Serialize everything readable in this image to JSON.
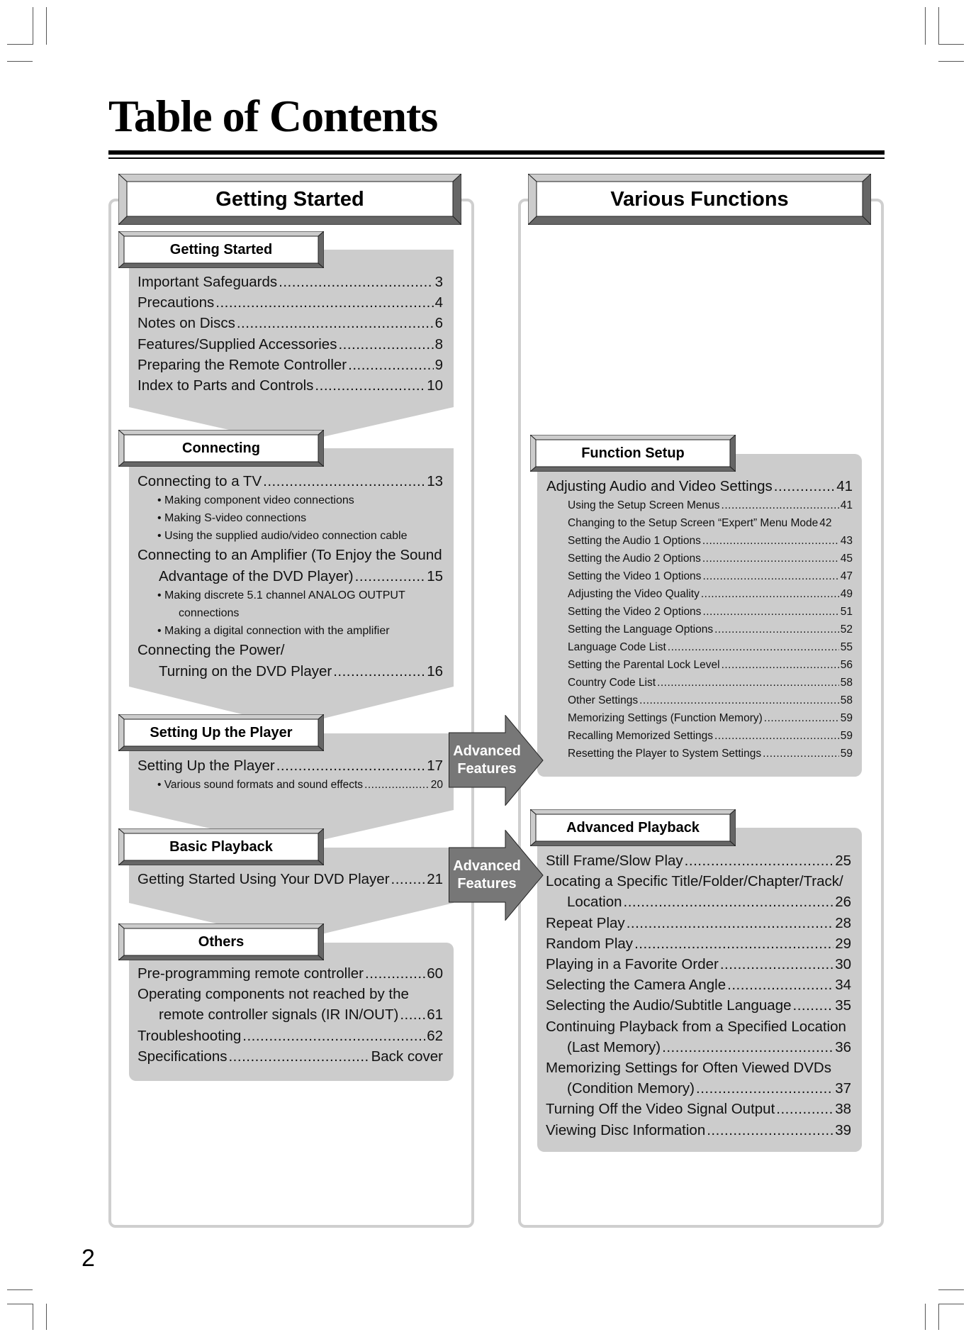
{
  "page": {
    "title": "Table of Contents",
    "page_number": "2"
  },
  "colors": {
    "panel_gray": "#cccccc",
    "frame_gray": "#cfcfcf",
    "arrow_gray": "#777777",
    "bevel_dark": "#666666",
    "bevel_light": "#cccccc"
  },
  "left_column": {
    "header": "Getting Started",
    "sections": [
      {
        "title": "Getting Started",
        "entries": [
          {
            "text": "Important Safeguards",
            "page": "3"
          },
          {
            "text": "Precautions",
            "page": "4"
          },
          {
            "text": "Notes on Discs",
            "page": "6"
          },
          {
            "text": "Features/Supplied Accessories",
            "page": "8"
          },
          {
            "text": "Preparing the Remote Controller",
            "page": "9"
          },
          {
            "text": "Index to Parts and Controls",
            "page": "10"
          }
        ]
      },
      {
        "title": "Connecting",
        "entries": [
          {
            "text": "Connecting to a TV",
            "page": "13"
          },
          {
            "text": "Making component video connections"
          },
          {
            "text": "Making S-video connections"
          },
          {
            "text": "Using the supplied audio/video connection cable"
          },
          {
            "text": "Connecting to an Amplifier (To Enjoy the Sound"
          },
          {
            "text": "Advantage of the DVD Player)",
            "page": "15"
          },
          {
            "text": "Making discrete 5.1 channel ANALOG OUTPUT"
          },
          {
            "text": "connections"
          },
          {
            "text": "Making a digital connection with the amplifier"
          },
          {
            "text": "Connecting the Power/"
          },
          {
            "text": "Turning on the DVD Player",
            "page": "16"
          }
        ]
      },
      {
        "title": "Setting Up the Player",
        "entries": [
          {
            "text": "Setting Up the Player",
            "page": "17"
          },
          {
            "text": "Various sound formats and sound effects",
            "page": "20"
          }
        ]
      },
      {
        "title": "Basic Playback",
        "entries": [
          {
            "text": "Getting Started Using Your DVD Player",
            "page": "21"
          }
        ]
      },
      {
        "title": "Others",
        "entries": [
          {
            "text": "Pre-programming remote controller",
            "page": "60"
          },
          {
            "text": "Operating components not reached by the"
          },
          {
            "text": "remote controller signals (IR IN/OUT)",
            "page": "61"
          },
          {
            "text": "Troubleshooting",
            "page": "62"
          },
          {
            "text": "Specifications",
            "page": "Back cover"
          }
        ]
      }
    ]
  },
  "arrows": [
    {
      "line1": "Advanced",
      "line2": "Features"
    },
    {
      "line1": "Advanced",
      "line2": "Features"
    }
  ],
  "right_column": {
    "header": "Various Functions",
    "sections": [
      {
        "title": "Function Setup",
        "entries": [
          {
            "text": "Adjusting Audio and Video Settings",
            "page": "41"
          },
          {
            "text": "Using the Setup Screen Menus",
            "page": "41"
          },
          {
            "text": "Changing to the Setup Screen “Expert” Menu Mode",
            "page": "42"
          },
          {
            "text": "Setting the Audio 1 Options",
            "page": "43"
          },
          {
            "text": "Setting the Audio 2 Options",
            "page": "45"
          },
          {
            "text": "Setting the Video 1 Options",
            "page": "47"
          },
          {
            "text": "Adjusting the Video Quality",
            "page": "49"
          },
          {
            "text": "Setting the Video 2 Options",
            "page": "51"
          },
          {
            "text": "Setting the Language Options",
            "page": "52"
          },
          {
            "text": "Language Code List",
            "page": "55"
          },
          {
            "text": "Setting the Parental Lock Level",
            "page": "56"
          },
          {
            "text": "Country Code List",
            "page": "58"
          },
          {
            "text": "Other Settings",
            "page": "58"
          },
          {
            "text": "Memorizing Settings (Function Memory)",
            "page": "59"
          },
          {
            "text": "Recalling Memorized Settings",
            "page": "59"
          },
          {
            "text": "Resetting the Player to System Settings",
            "page": "59"
          }
        ]
      },
      {
        "title": "Advanced Playback",
        "entries": [
          {
            "text": "Still Frame/Slow Play",
            "page": "25"
          },
          {
            "text": "Locating a Specific Title/Folder/Chapter/Track/"
          },
          {
            "text": "Location",
            "page": "26"
          },
          {
            "text": "Repeat Play",
            "page": "28"
          },
          {
            "text": "Random Play",
            "page": "29"
          },
          {
            "text": "Playing in a Favorite Order",
            "page": "30"
          },
          {
            "text": "Selecting the Camera Angle",
            "page": "34"
          },
          {
            "text": "Selecting the Audio/Subtitle Language",
            "page": "35"
          },
          {
            "text": "Continuing Playback from a Specified Location"
          },
          {
            "text": "(Last Memory)",
            "page": "36"
          },
          {
            "text": "Memorizing Settings for Often Viewed DVDs"
          },
          {
            "text": "(Condition Memory)",
            "page": "37"
          },
          {
            "text": "Turning Off the Video Signal Output",
            "page": "38"
          },
          {
            "text": "Viewing Disc Information",
            "page": "39"
          }
        ]
      }
    ]
  }
}
